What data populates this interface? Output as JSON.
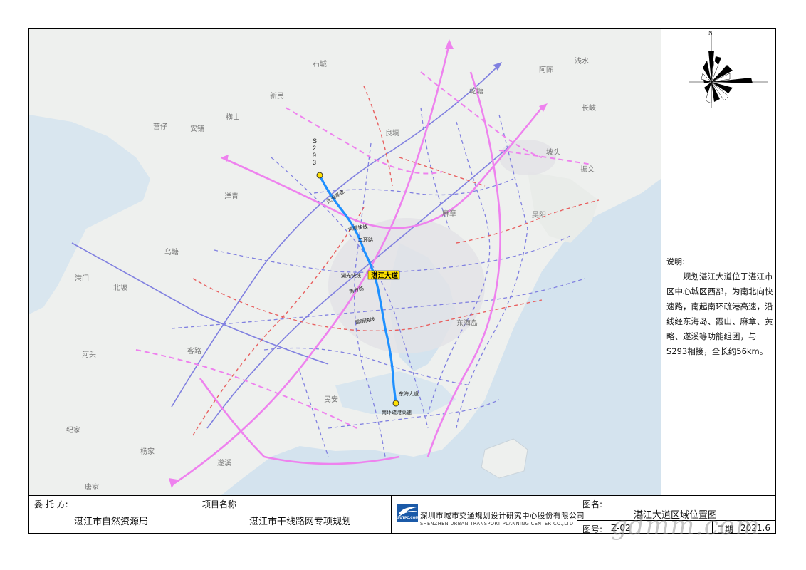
{
  "map": {
    "cities": [
      {
        "name": "石城"
      },
      {
        "name": "新民"
      },
      {
        "name": "安铺"
      },
      {
        "name": "横山"
      },
      {
        "name": "营仔"
      },
      {
        "name": "良垌"
      },
      {
        "name": "洋青"
      },
      {
        "name": "乌塘"
      },
      {
        "name": "港门"
      },
      {
        "name": "北坡"
      },
      {
        "name": "河头"
      },
      {
        "name": "客路"
      },
      {
        "name": "杨家"
      },
      {
        "name": "纪家"
      },
      {
        "name": "唐家"
      },
      {
        "name": "遂溪"
      },
      {
        "name": "阿陈"
      },
      {
        "name": "浅水"
      },
      {
        "name": "长岐"
      },
      {
        "name": "坡头"
      },
      {
        "name": "振文"
      },
      {
        "name": "吴阳"
      },
      {
        "name": "乾塘"
      },
      {
        "name": "麻章"
      },
      {
        "name": "东海岛"
      },
      {
        "name": "民安"
      }
    ],
    "route_label": "湛江大道",
    "route_endpoint_north": "S293",
    "road_labels": {
      "expressway_north": "沈海高速",
      "runkou": "调顺快线",
      "ring2": "二环路",
      "huguang": "湖光快线",
      "nanfang": "南方路",
      "leinan": "雷南快线",
      "donghai": "东海大道",
      "nanhuan": "南环疏港高速"
    },
    "colors": {
      "zhanjiang_avenue": "#1e90ff",
      "expressway": "#ee82ee",
      "planned_expressway": "#ee82ee",
      "fast_road": "#8080e0",
      "planned_red": "#e86060",
      "land": "#eef0ee",
      "sea": "#d4e3ee"
    }
  },
  "compass": {
    "north_label": "N"
  },
  "notes": {
    "title": "说明:",
    "body": "规划湛江大道位于湛江市区中心城区西部，为南北向快速路，南起南环疏港高速，沿线经东海岛、霞山、麻章、黄略、遂溪等功能组团，与S293相接，全长约56km。"
  },
  "title_block": {
    "client_label": "委 托 方:",
    "client_value": "湛江市自然资源局",
    "project_label": "项目名称",
    "project_value": "湛江市干线路网专项规划",
    "company_cn": "深圳市城市交通规划设计研究中心股份有限公司",
    "company_en": "SHENZHEN URBAN TRANSPORT PLANNING CENTER CO.,LTD",
    "logo_text": "SUTPC.COM",
    "drawing_name_label": "图名:",
    "drawing_name_value": "湛江大道区域位置图",
    "drawing_no_label": "图号:",
    "drawing_no_value": "Z-02",
    "date_label": "日期",
    "date_value": "2021.6"
  },
  "watermark": "gdmm.com"
}
